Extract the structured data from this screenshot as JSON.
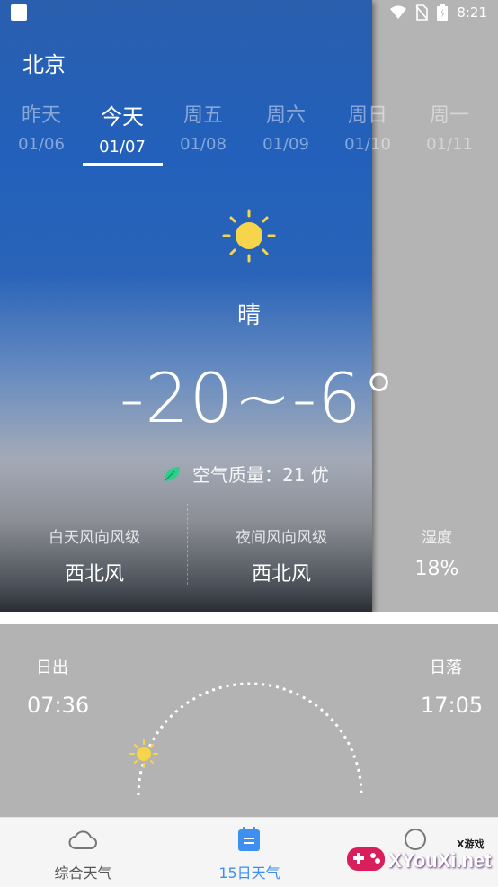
{
  "status_bar": {
    "time": "8:21"
  },
  "city": "北京",
  "days": [
    {
      "name": "昨天",
      "date": "01/06",
      "active": false
    },
    {
      "name": "今天",
      "date": "01/07",
      "active": true
    },
    {
      "name": "周五",
      "date": "01/08",
      "active": false
    },
    {
      "name": "周六",
      "date": "01/09",
      "active": false
    },
    {
      "name": "周日",
      "date": "01/10",
      "active": false
    },
    {
      "name": "周一",
      "date": "01/11",
      "active": false
    }
  ],
  "today": {
    "condition": "晴",
    "temperature": "-20~-6°",
    "aqi": "空气质量：21 优",
    "day_wind_label": "白天风向风级",
    "day_wind_value": "西北风",
    "night_wind_label": "夜间风向风级",
    "night_wind_value": "西北风",
    "humidity_label": "湿度",
    "humidity_value": "18%"
  },
  "sun": {
    "sunrise_label": "日出",
    "sunrise_time": "07:36",
    "sunset_label": "日落",
    "sunset_time": "17:05"
  },
  "nav": [
    {
      "label": "综合天气",
      "active": false
    },
    {
      "label": "15日天气",
      "active": true
    }
  ],
  "watermark": {
    "text": "XYouXi.net",
    "small": "X游戏"
  },
  "colors": {
    "accent": "#3d8ff0",
    "sun": "#f6d54a",
    "leaf": "#2ecf8a"
  }
}
